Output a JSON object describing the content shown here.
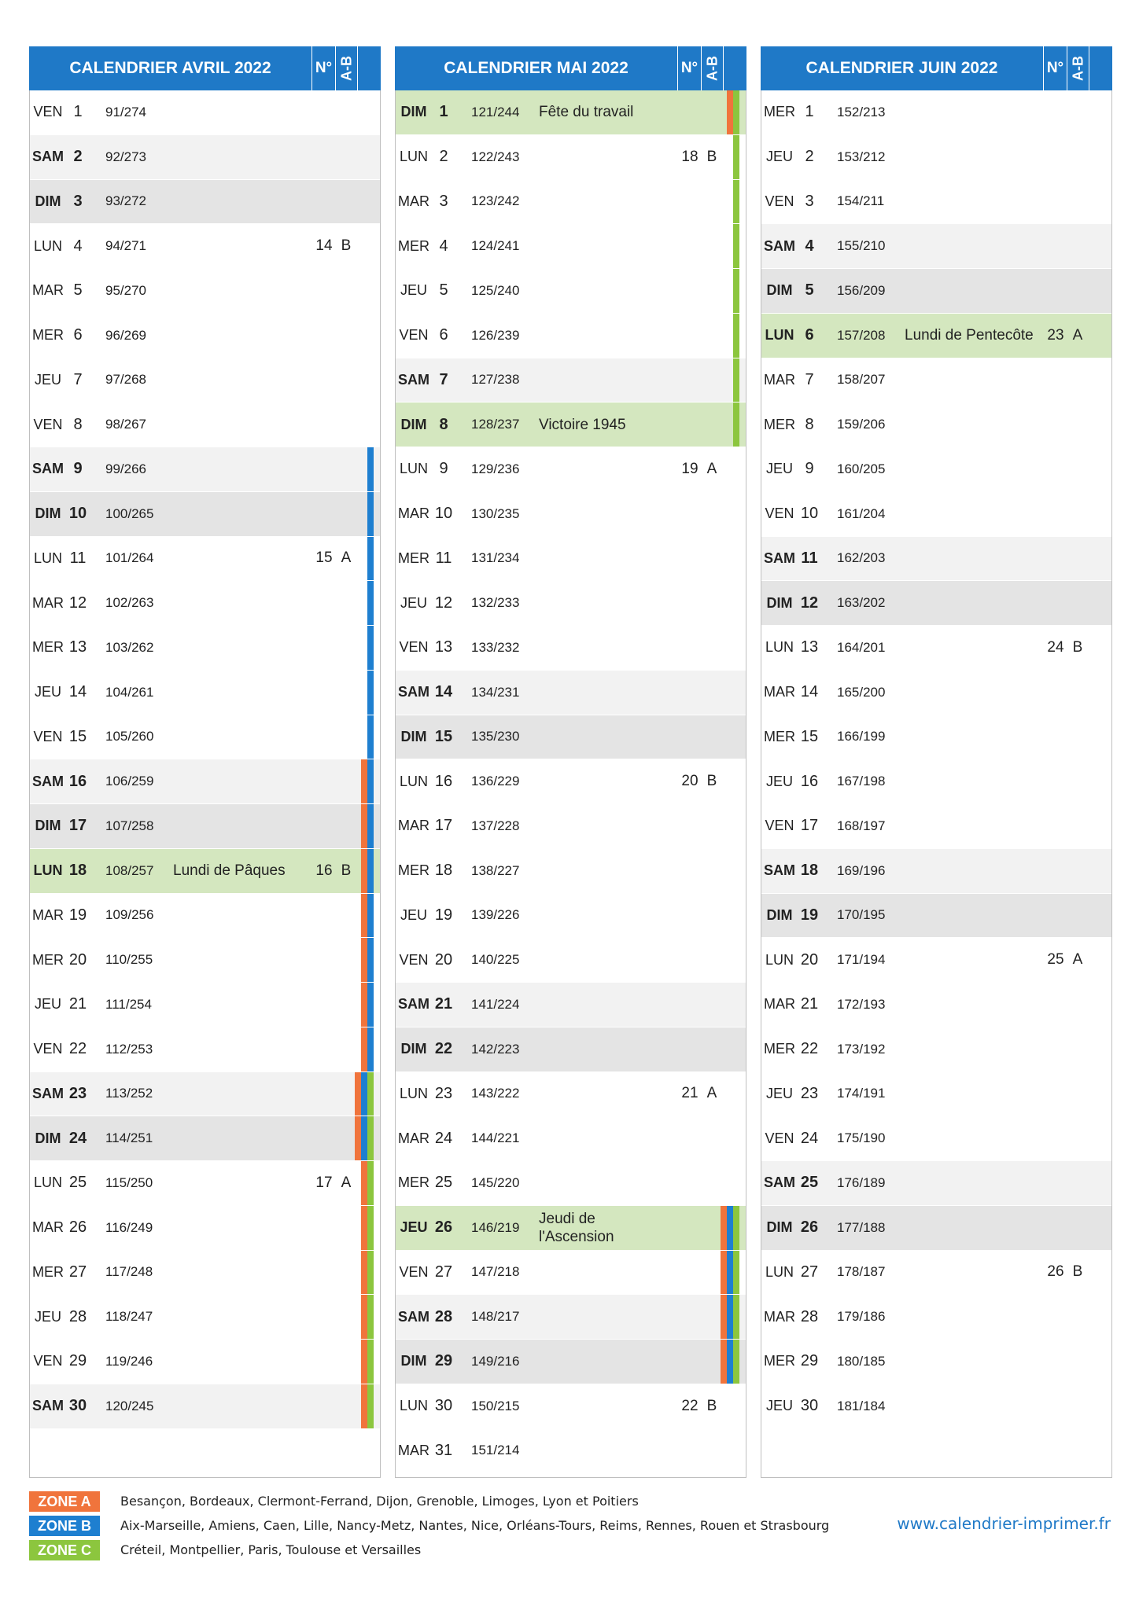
{
  "colors": {
    "header": "#1f79c7",
    "zone_a": "#f0743c",
    "zone_b": "#1e7fd0",
    "zone_c": "#8cc63e",
    "holiday": "#d4e7bf",
    "saturday": "#f2f2f2",
    "sunday": "#e4e4e4"
  },
  "header_labels": {
    "week": "N°",
    "ab": "A-B"
  },
  "months": [
    {
      "title": "CALENDRIER AVRIL 2022",
      "days": [
        {
          "dow": "VEN",
          "num": "1",
          "doy": "91/274",
          "name": "",
          "week": "",
          "ab": "",
          "type": "",
          "zones": ""
        },
        {
          "dow": "SAM",
          "num": "2",
          "doy": "92/273",
          "name": "",
          "week": "",
          "ab": "",
          "type": "sat",
          "zones": ""
        },
        {
          "dow": "DIM",
          "num": "3",
          "doy": "93/272",
          "name": "",
          "week": "",
          "ab": "",
          "type": "sun",
          "zones": ""
        },
        {
          "dow": "LUN",
          "num": "4",
          "doy": "94/271",
          "name": "",
          "week": "14",
          "ab": "B",
          "type": "",
          "zones": ""
        },
        {
          "dow": "MAR",
          "num": "5",
          "doy": "95/270",
          "name": "",
          "week": "",
          "ab": "",
          "type": "",
          "zones": ""
        },
        {
          "dow": "MER",
          "num": "6",
          "doy": "96/269",
          "name": "",
          "week": "",
          "ab": "",
          "type": "",
          "zones": ""
        },
        {
          "dow": "JEU",
          "num": "7",
          "doy": "97/268",
          "name": "",
          "week": "",
          "ab": "",
          "type": "",
          "zones": ""
        },
        {
          "dow": "VEN",
          "num": "8",
          "doy": "98/267",
          "name": "",
          "week": "",
          "ab": "",
          "type": "",
          "zones": ""
        },
        {
          "dow": "SAM",
          "num": "9",
          "doy": "99/266",
          "name": "",
          "week": "",
          "ab": "",
          "type": "sat",
          "zones": "B"
        },
        {
          "dow": "DIM",
          "num": "10",
          "doy": "100/265",
          "name": "",
          "week": "",
          "ab": "",
          "type": "sun",
          "zones": "B"
        },
        {
          "dow": "LUN",
          "num": "11",
          "doy": "101/264",
          "name": "",
          "week": "15",
          "ab": "A",
          "type": "",
          "zones": "B"
        },
        {
          "dow": "MAR",
          "num": "12",
          "doy": "102/263",
          "name": "",
          "week": "",
          "ab": "",
          "type": "",
          "zones": "B"
        },
        {
          "dow": "MER",
          "num": "13",
          "doy": "103/262",
          "name": "",
          "week": "",
          "ab": "",
          "type": "",
          "zones": "B"
        },
        {
          "dow": "JEU",
          "num": "14",
          "doy": "104/261",
          "name": "",
          "week": "",
          "ab": "",
          "type": "",
          "zones": "B"
        },
        {
          "dow": "VEN",
          "num": "15",
          "doy": "105/260",
          "name": "",
          "week": "",
          "ab": "",
          "type": "",
          "zones": "B"
        },
        {
          "dow": "SAM",
          "num": "16",
          "doy": "106/259",
          "name": "",
          "week": "",
          "ab": "",
          "type": "sat",
          "zones": "AB"
        },
        {
          "dow": "DIM",
          "num": "17",
          "doy": "107/258",
          "name": "",
          "week": "",
          "ab": "",
          "type": "sun",
          "zones": "AB"
        },
        {
          "dow": "LUN",
          "num": "18",
          "doy": "108/257",
          "name": "Lundi de Pâques",
          "week": "16",
          "ab": "B",
          "type": "hol",
          "zones": "AB"
        },
        {
          "dow": "MAR",
          "num": "19",
          "doy": "109/256",
          "name": "",
          "week": "",
          "ab": "",
          "type": "",
          "zones": "AB"
        },
        {
          "dow": "MER",
          "num": "20",
          "doy": "110/255",
          "name": "",
          "week": "",
          "ab": "",
          "type": "",
          "zones": "AB"
        },
        {
          "dow": "JEU",
          "num": "21",
          "doy": "111/254",
          "name": "",
          "week": "",
          "ab": "",
          "type": "",
          "zones": "AB"
        },
        {
          "dow": "VEN",
          "num": "22",
          "doy": "112/253",
          "name": "",
          "week": "",
          "ab": "",
          "type": "",
          "zones": "AB"
        },
        {
          "dow": "SAM",
          "num": "23",
          "doy": "113/252",
          "name": "",
          "week": "",
          "ab": "",
          "type": "sat",
          "zones": "ABC"
        },
        {
          "dow": "DIM",
          "num": "24",
          "doy": "114/251",
          "name": "",
          "week": "",
          "ab": "",
          "type": "sun",
          "zones": "ABC"
        },
        {
          "dow": "LUN",
          "num": "25",
          "doy": "115/250",
          "name": "",
          "week": "17",
          "ab": "A",
          "type": "",
          "zones": "AC"
        },
        {
          "dow": "MAR",
          "num": "26",
          "doy": "116/249",
          "name": "",
          "week": "",
          "ab": "",
          "type": "",
          "zones": "AC"
        },
        {
          "dow": "MER",
          "num": "27",
          "doy": "117/248",
          "name": "",
          "week": "",
          "ab": "",
          "type": "",
          "zones": "AC"
        },
        {
          "dow": "JEU",
          "num": "28",
          "doy": "118/247",
          "name": "",
          "week": "",
          "ab": "",
          "type": "",
          "zones": "AC"
        },
        {
          "dow": "VEN",
          "num": "29",
          "doy": "119/246",
          "name": "",
          "week": "",
          "ab": "",
          "type": "",
          "zones": "AC"
        },
        {
          "dow": "SAM",
          "num": "30",
          "doy": "120/245",
          "name": "",
          "week": "",
          "ab": "",
          "type": "sat",
          "zones": "AC"
        }
      ]
    },
    {
      "title": "CALENDRIER MAI 2022",
      "days": [
        {
          "dow": "DIM",
          "num": "1",
          "doy": "121/244",
          "name": "Fête du travail",
          "week": "",
          "ab": "",
          "type": "hol",
          "zones": "AC"
        },
        {
          "dow": "LUN",
          "num": "2",
          "doy": "122/243",
          "name": "",
          "week": "18",
          "ab": "B",
          "type": "",
          "zones": "C"
        },
        {
          "dow": "MAR",
          "num": "3",
          "doy": "123/242",
          "name": "",
          "week": "",
          "ab": "",
          "type": "",
          "zones": "C"
        },
        {
          "dow": "MER",
          "num": "4",
          "doy": "124/241",
          "name": "",
          "week": "",
          "ab": "",
          "type": "",
          "zones": "C"
        },
        {
          "dow": "JEU",
          "num": "5",
          "doy": "125/240",
          "name": "",
          "week": "",
          "ab": "",
          "type": "",
          "zones": "C"
        },
        {
          "dow": "VEN",
          "num": "6",
          "doy": "126/239",
          "name": "",
          "week": "",
          "ab": "",
          "type": "",
          "zones": "C"
        },
        {
          "dow": "SAM",
          "num": "7",
          "doy": "127/238",
          "name": "",
          "week": "",
          "ab": "",
          "type": "sat",
          "zones": "C"
        },
        {
          "dow": "DIM",
          "num": "8",
          "doy": "128/237",
          "name": "Victoire 1945",
          "week": "",
          "ab": "",
          "type": "hol",
          "zones": "C"
        },
        {
          "dow": "LUN",
          "num": "9",
          "doy": "129/236",
          "name": "",
          "week": "19",
          "ab": "A",
          "type": "",
          "zones": ""
        },
        {
          "dow": "MAR",
          "num": "10",
          "doy": "130/235",
          "name": "",
          "week": "",
          "ab": "",
          "type": "",
          "zones": ""
        },
        {
          "dow": "MER",
          "num": "11",
          "doy": "131/234",
          "name": "",
          "week": "",
          "ab": "",
          "type": "",
          "zones": ""
        },
        {
          "dow": "JEU",
          "num": "12",
          "doy": "132/233",
          "name": "",
          "week": "",
          "ab": "",
          "type": "",
          "zones": ""
        },
        {
          "dow": "VEN",
          "num": "13",
          "doy": "133/232",
          "name": "",
          "week": "",
          "ab": "",
          "type": "",
          "zones": ""
        },
        {
          "dow": "SAM",
          "num": "14",
          "doy": "134/231",
          "name": "",
          "week": "",
          "ab": "",
          "type": "sat",
          "zones": ""
        },
        {
          "dow": "DIM",
          "num": "15",
          "doy": "135/230",
          "name": "",
          "week": "",
          "ab": "",
          "type": "sun",
          "zones": ""
        },
        {
          "dow": "LUN",
          "num": "16",
          "doy": "136/229",
          "name": "",
          "week": "20",
          "ab": "B",
          "type": "",
          "zones": ""
        },
        {
          "dow": "MAR",
          "num": "17",
          "doy": "137/228",
          "name": "",
          "week": "",
          "ab": "",
          "type": "",
          "zones": ""
        },
        {
          "dow": "MER",
          "num": "18",
          "doy": "138/227",
          "name": "",
          "week": "",
          "ab": "",
          "type": "",
          "zones": ""
        },
        {
          "dow": "JEU",
          "num": "19",
          "doy": "139/226",
          "name": "",
          "week": "",
          "ab": "",
          "type": "",
          "zones": ""
        },
        {
          "dow": "VEN",
          "num": "20",
          "doy": "140/225",
          "name": "",
          "week": "",
          "ab": "",
          "type": "",
          "zones": ""
        },
        {
          "dow": "SAM",
          "num": "21",
          "doy": "141/224",
          "name": "",
          "week": "",
          "ab": "",
          "type": "sat",
          "zones": ""
        },
        {
          "dow": "DIM",
          "num": "22",
          "doy": "142/223",
          "name": "",
          "week": "",
          "ab": "",
          "type": "sun",
          "zones": ""
        },
        {
          "dow": "LUN",
          "num": "23",
          "doy": "143/222",
          "name": "",
          "week": "21",
          "ab": "A",
          "type": "",
          "zones": ""
        },
        {
          "dow": "MAR",
          "num": "24",
          "doy": "144/221",
          "name": "",
          "week": "",
          "ab": "",
          "type": "",
          "zones": ""
        },
        {
          "dow": "MER",
          "num": "25",
          "doy": "145/220",
          "name": "",
          "week": "",
          "ab": "",
          "type": "",
          "zones": ""
        },
        {
          "dow": "JEU",
          "num": "26",
          "doy": "146/219",
          "name": "Jeudi de l'Ascension",
          "week": "",
          "ab": "",
          "type": "hol",
          "zones": "ABC"
        },
        {
          "dow": "VEN",
          "num": "27",
          "doy": "147/218",
          "name": "",
          "week": "",
          "ab": "",
          "type": "",
          "zones": "ABC"
        },
        {
          "dow": "SAM",
          "num": "28",
          "doy": "148/217",
          "name": "",
          "week": "",
          "ab": "",
          "type": "sat",
          "zones": "ABC"
        },
        {
          "dow": "DIM",
          "num": "29",
          "doy": "149/216",
          "name": "",
          "week": "",
          "ab": "",
          "type": "sun",
          "zones": "ABC"
        },
        {
          "dow": "LUN",
          "num": "30",
          "doy": "150/215",
          "name": "",
          "week": "22",
          "ab": "B",
          "type": "",
          "zones": ""
        },
        {
          "dow": "MAR",
          "num": "31",
          "doy": "151/214",
          "name": "",
          "week": "",
          "ab": "",
          "type": "",
          "zones": ""
        }
      ]
    },
    {
      "title": "CALENDRIER JUIN 2022",
      "days": [
        {
          "dow": "MER",
          "num": "1",
          "doy": "152/213",
          "name": "",
          "week": "",
          "ab": "",
          "type": "",
          "zones": ""
        },
        {
          "dow": "JEU",
          "num": "2",
          "doy": "153/212",
          "name": "",
          "week": "",
          "ab": "",
          "type": "",
          "zones": ""
        },
        {
          "dow": "VEN",
          "num": "3",
          "doy": "154/211",
          "name": "",
          "week": "",
          "ab": "",
          "type": "",
          "zones": ""
        },
        {
          "dow": "SAM",
          "num": "4",
          "doy": "155/210",
          "name": "",
          "week": "",
          "ab": "",
          "type": "sat",
          "zones": ""
        },
        {
          "dow": "DIM",
          "num": "5",
          "doy": "156/209",
          "name": "",
          "week": "",
          "ab": "",
          "type": "sun",
          "zones": ""
        },
        {
          "dow": "LUN",
          "num": "6",
          "doy": "157/208",
          "name": "Lundi de Pentecôte",
          "week": "23",
          "ab": "A",
          "type": "hol",
          "zones": ""
        },
        {
          "dow": "MAR",
          "num": "7",
          "doy": "158/207",
          "name": "",
          "week": "",
          "ab": "",
          "type": "",
          "zones": ""
        },
        {
          "dow": "MER",
          "num": "8",
          "doy": "159/206",
          "name": "",
          "week": "",
          "ab": "",
          "type": "",
          "zones": ""
        },
        {
          "dow": "JEU",
          "num": "9",
          "doy": "160/205",
          "name": "",
          "week": "",
          "ab": "",
          "type": "",
          "zones": ""
        },
        {
          "dow": "VEN",
          "num": "10",
          "doy": "161/204",
          "name": "",
          "week": "",
          "ab": "",
          "type": "",
          "zones": ""
        },
        {
          "dow": "SAM",
          "num": "11",
          "doy": "162/203",
          "name": "",
          "week": "",
          "ab": "",
          "type": "sat",
          "zones": ""
        },
        {
          "dow": "DIM",
          "num": "12",
          "doy": "163/202",
          "name": "",
          "week": "",
          "ab": "",
          "type": "sun",
          "zones": ""
        },
        {
          "dow": "LUN",
          "num": "13",
          "doy": "164/201",
          "name": "",
          "week": "24",
          "ab": "B",
          "type": "",
          "zones": ""
        },
        {
          "dow": "MAR",
          "num": "14",
          "doy": "165/200",
          "name": "",
          "week": "",
          "ab": "",
          "type": "",
          "zones": ""
        },
        {
          "dow": "MER",
          "num": "15",
          "doy": "166/199",
          "name": "",
          "week": "",
          "ab": "",
          "type": "",
          "zones": ""
        },
        {
          "dow": "JEU",
          "num": "16",
          "doy": "167/198",
          "name": "",
          "week": "",
          "ab": "",
          "type": "",
          "zones": ""
        },
        {
          "dow": "VEN",
          "num": "17",
          "doy": "168/197",
          "name": "",
          "week": "",
          "ab": "",
          "type": "",
          "zones": ""
        },
        {
          "dow": "SAM",
          "num": "18",
          "doy": "169/196",
          "name": "",
          "week": "",
          "ab": "",
          "type": "sat",
          "zones": ""
        },
        {
          "dow": "DIM",
          "num": "19",
          "doy": "170/195",
          "name": "",
          "week": "",
          "ab": "",
          "type": "sun",
          "zones": ""
        },
        {
          "dow": "LUN",
          "num": "20",
          "doy": "171/194",
          "name": "",
          "week": "25",
          "ab": "A",
          "type": "",
          "zones": ""
        },
        {
          "dow": "MAR",
          "num": "21",
          "doy": "172/193",
          "name": "",
          "week": "",
          "ab": "",
          "type": "",
          "zones": ""
        },
        {
          "dow": "MER",
          "num": "22",
          "doy": "173/192",
          "name": "",
          "week": "",
          "ab": "",
          "type": "",
          "zones": ""
        },
        {
          "dow": "JEU",
          "num": "23",
          "doy": "174/191",
          "name": "",
          "week": "",
          "ab": "",
          "type": "",
          "zones": ""
        },
        {
          "dow": "VEN",
          "num": "24",
          "doy": "175/190",
          "name": "",
          "week": "",
          "ab": "",
          "type": "",
          "zones": ""
        },
        {
          "dow": "SAM",
          "num": "25",
          "doy": "176/189",
          "name": "",
          "week": "",
          "ab": "",
          "type": "sat",
          "zones": ""
        },
        {
          "dow": "DIM",
          "num": "26",
          "doy": "177/188",
          "name": "",
          "week": "",
          "ab": "",
          "type": "sun",
          "zones": ""
        },
        {
          "dow": "LUN",
          "num": "27",
          "doy": "178/187",
          "name": "",
          "week": "26",
          "ab": "B",
          "type": "",
          "zones": ""
        },
        {
          "dow": "MAR",
          "num": "28",
          "doy": "179/186",
          "name": "",
          "week": "",
          "ab": "",
          "type": "",
          "zones": ""
        },
        {
          "dow": "MER",
          "num": "29",
          "doy": "180/185",
          "name": "",
          "week": "",
          "ab": "",
          "type": "",
          "zones": ""
        },
        {
          "dow": "JEU",
          "num": "30",
          "doy": "181/184",
          "name": "",
          "week": "",
          "ab": "",
          "type": "",
          "zones": ""
        }
      ]
    }
  ],
  "legend": [
    {
      "label": "ZONE A",
      "text": "Besançon, Bordeaux, Clermont-Ferrand, Dijon, Grenoble, Limoges, Lyon et Poitiers",
      "zone": "a"
    },
    {
      "label": "ZONE B",
      "text": "Aix-Marseille, Amiens, Caen, Lille, Nancy-Metz, Nantes, Nice, Orléans-Tours, Reims, Rennes, Rouen et Strasbourg",
      "zone": "b"
    },
    {
      "label": "ZONE C",
      "text": "Créteil, Montpellier, Paris, Toulouse et Versailles",
      "zone": "c"
    }
  ],
  "website": "www.calendrier-imprimer.fr"
}
